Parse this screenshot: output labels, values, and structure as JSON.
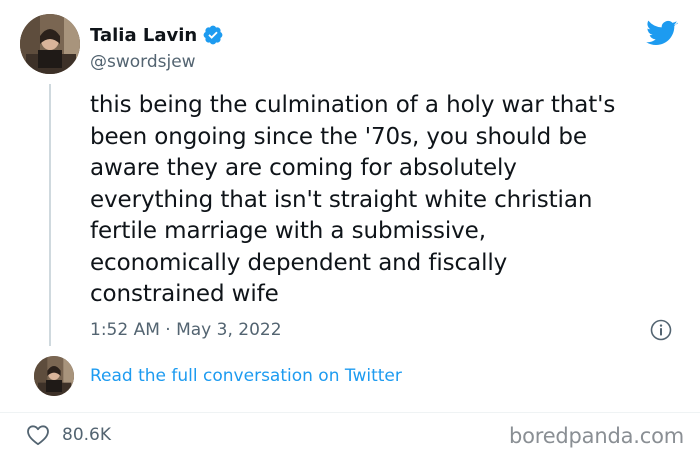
{
  "author": {
    "display_name": "Talia Lavin",
    "handle": "@swordsjew",
    "verified": true
  },
  "tweet": {
    "text": "this being the culmination of a holy war that's\nbeen ongoing since the '70s, you should be\naware they are coming for absolutely\neverything that isn't straight white christian\nfertile marriage with a submissive,\neconomically dependent and fiscally\nconstrained wife",
    "timestamp": "1:52 AM · May 3, 2022"
  },
  "actions": {
    "read_conversation": "Read the full conversation on Twitter",
    "like_count": "80.6K"
  },
  "watermark": "boredpanda.com",
  "colors": {
    "accent": "#1d9bf0",
    "text": "#0f1419",
    "muted": "#536471",
    "divider": "#eff3f4"
  },
  "icons": [
    "verified-badge-icon",
    "twitter-bird-icon",
    "info-icon",
    "heart-icon"
  ]
}
